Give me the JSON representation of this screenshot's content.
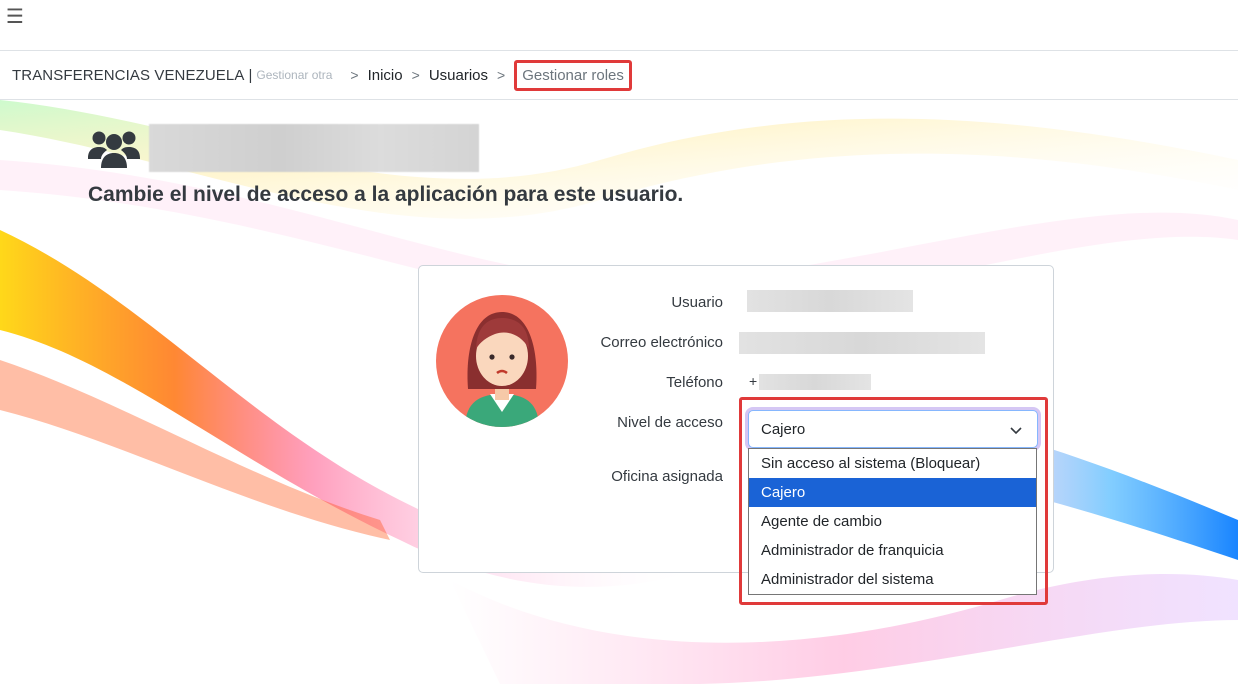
{
  "topbar": {
    "menu_icon": "hamburger-icon"
  },
  "breadcrumb": {
    "brand": "TRANSFERENCIAS VENEZUELA",
    "brand_separator": "|",
    "manage_other": "Gestionar otra",
    "separator": ">",
    "items": [
      "Inicio",
      "Usuarios"
    ],
    "current": "Gestionar roles"
  },
  "header": {
    "icon": "users-icon",
    "title": "Cambie el nivel de acceso a la aplicación para este usuario."
  },
  "card": {
    "avatar": "user-avatar-female",
    "labels": {
      "usuario": "Usuario",
      "correo": "Correo electrónico",
      "telefono": "Teléfono",
      "nivel": "Nivel de acceso",
      "oficina": "Oficina asignada"
    },
    "phone_prefix": "+",
    "access_level": {
      "selected": "Cajero",
      "options": [
        "Sin acceso al sistema (Bloquear)",
        "Cajero",
        "Agente de cambio",
        "Administrador de franquicia",
        "Administrador del sistema"
      ]
    }
  },
  "colors": {
    "highlight": "#e03a3a",
    "option_selected": "#1a63d6",
    "select_focus": "#b399eb"
  }
}
